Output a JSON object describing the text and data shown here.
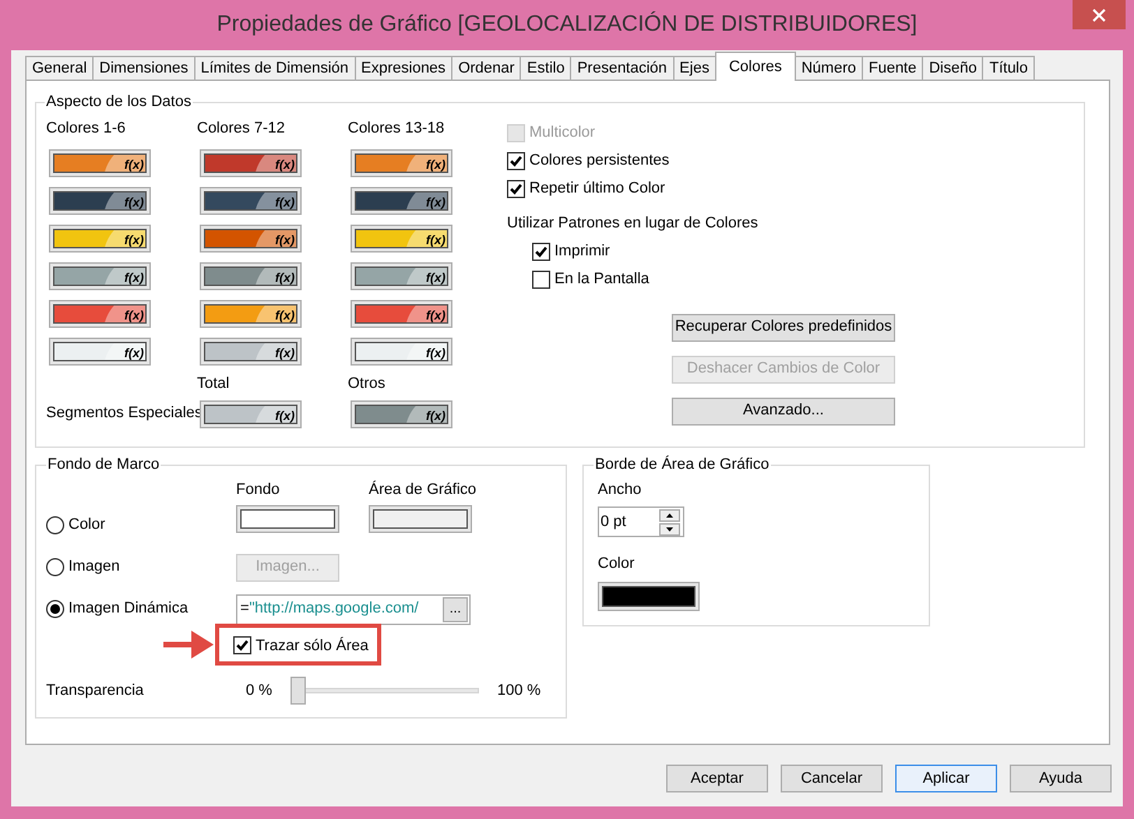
{
  "window": {
    "title": "Propiedades de Gráfico [GEOLOCALIZACIÓN DE DISTRIBUIDORES]"
  },
  "tabs": [
    {
      "label": "General",
      "selected": false
    },
    {
      "label": "Dimensiones",
      "selected": false
    },
    {
      "label": "Límites de Dimensión",
      "selected": false
    },
    {
      "label": "Expresiones",
      "selected": false
    },
    {
      "label": "Ordenar",
      "selected": false
    },
    {
      "label": "Estilo",
      "selected": false
    },
    {
      "label": "Presentación",
      "selected": false
    },
    {
      "label": "Ejes",
      "selected": false
    },
    {
      "label": "Colores",
      "selected": true
    },
    {
      "label": "Número",
      "selected": false
    },
    {
      "label": "Fuente",
      "selected": false
    },
    {
      "label": "Diseño",
      "selected": false
    },
    {
      "label": "Título",
      "selected": false
    }
  ],
  "data_appearance": {
    "title": "Aspecto de los Datos",
    "color_columns": [
      {
        "label": "Colores 1-6",
        "swatches": [
          {
            "color": "#e67e22",
            "fx": "f(x)"
          },
          {
            "color": "#2c3e50",
            "fx": "f(x)"
          },
          {
            "color": "#f1c40f",
            "fx": "f(x)"
          },
          {
            "color": "#95a5a6",
            "fx": "f(x)"
          },
          {
            "color": "#e74c3c",
            "fx": "f(x)"
          },
          {
            "color": "#ecf0f1",
            "fx": "f(x)"
          }
        ]
      },
      {
        "label": "Colores 7-12",
        "swatches": [
          {
            "color": "#c0392b",
            "fx": "f(x)"
          },
          {
            "color": "#34495e",
            "fx": "f(x)"
          },
          {
            "color": "#d35400",
            "fx": "f(x)"
          },
          {
            "color": "#7f8c8d",
            "fx": "f(x)"
          },
          {
            "color": "#f39c12",
            "fx": "f(x)"
          },
          {
            "color": "#bdc3c7",
            "fx": "f(x)"
          }
        ]
      },
      {
        "label": "Colores 13-18",
        "swatches": [
          {
            "color": "#e67e22",
            "fx": "f(x)"
          },
          {
            "color": "#2c3e50",
            "fx": "f(x)"
          },
          {
            "color": "#f1c40f",
            "fx": "f(x)"
          },
          {
            "color": "#95a5a6",
            "fx": "f(x)"
          },
          {
            "color": "#e74c3c",
            "fx": "f(x)"
          },
          {
            "color": "#ecf0f1",
            "fx": "f(x)"
          }
        ]
      }
    ],
    "special_segments": {
      "label": "Segmentos Especiales",
      "items": [
        {
          "label": "Total",
          "color": "#bdc3c7",
          "fx": "f(x)"
        },
        {
          "label": "Otros",
          "color": "#7f8c8d",
          "fx": "f(x)"
        }
      ]
    },
    "options": [
      {
        "label": "Multicolor",
        "checked": false,
        "disabled": true
      },
      {
        "label": "Colores persistentes",
        "checked": true,
        "disabled": false
      },
      {
        "label": "Repetir último Color",
        "checked": true,
        "disabled": false
      }
    ],
    "patterns": {
      "label": "Utilizar Patrones en lugar de Colores",
      "options": [
        {
          "label": "Imprimir",
          "checked": true
        },
        {
          "label": "En la Pantalla",
          "checked": false
        }
      ]
    },
    "buttons": [
      {
        "label": "Recuperar Colores predefinidos",
        "disabled": false
      },
      {
        "label": "Deshacer Cambios de Color",
        "disabled": true
      },
      {
        "label": "Avanzado...",
        "disabled": false
      }
    ]
  },
  "frame_background": {
    "title": "Fondo de Marco",
    "swatches": [
      {
        "label": "Fondo",
        "color": "#ffffff"
      },
      {
        "label": "Área de Gráfico",
        "color": "#f0f0f0"
      }
    ],
    "modes": [
      {
        "label": "Color",
        "selected": false
      },
      {
        "label": "Imagen",
        "selected": false
      },
      {
        "label": "Imagen Dinámica",
        "selected": true
      }
    ],
    "image_button": {
      "label": "Imagen...",
      "disabled": true
    },
    "dynamic_image": {
      "prefix": "=",
      "value": "\"http://maps.google.com/",
      "button": "..."
    },
    "plot_area_only": {
      "label": "Trazar sólo Área",
      "checked": true
    },
    "transparency": {
      "label": "Transparencia",
      "min": "0 %",
      "max": "100 %",
      "level": 0
    }
  },
  "plot_area_border": {
    "title": "Borde de Área de Gráfico",
    "width_label": "Ancho",
    "width_value": "0 pt",
    "color_label": "Color",
    "color": "#000000"
  },
  "dialog_buttons": [
    {
      "label": "Aceptar",
      "focused": false
    },
    {
      "label": "Cancelar",
      "focused": false
    },
    {
      "label": "Aplicar",
      "focused": true
    },
    {
      "label": "Ayuda",
      "focused": false
    }
  ]
}
